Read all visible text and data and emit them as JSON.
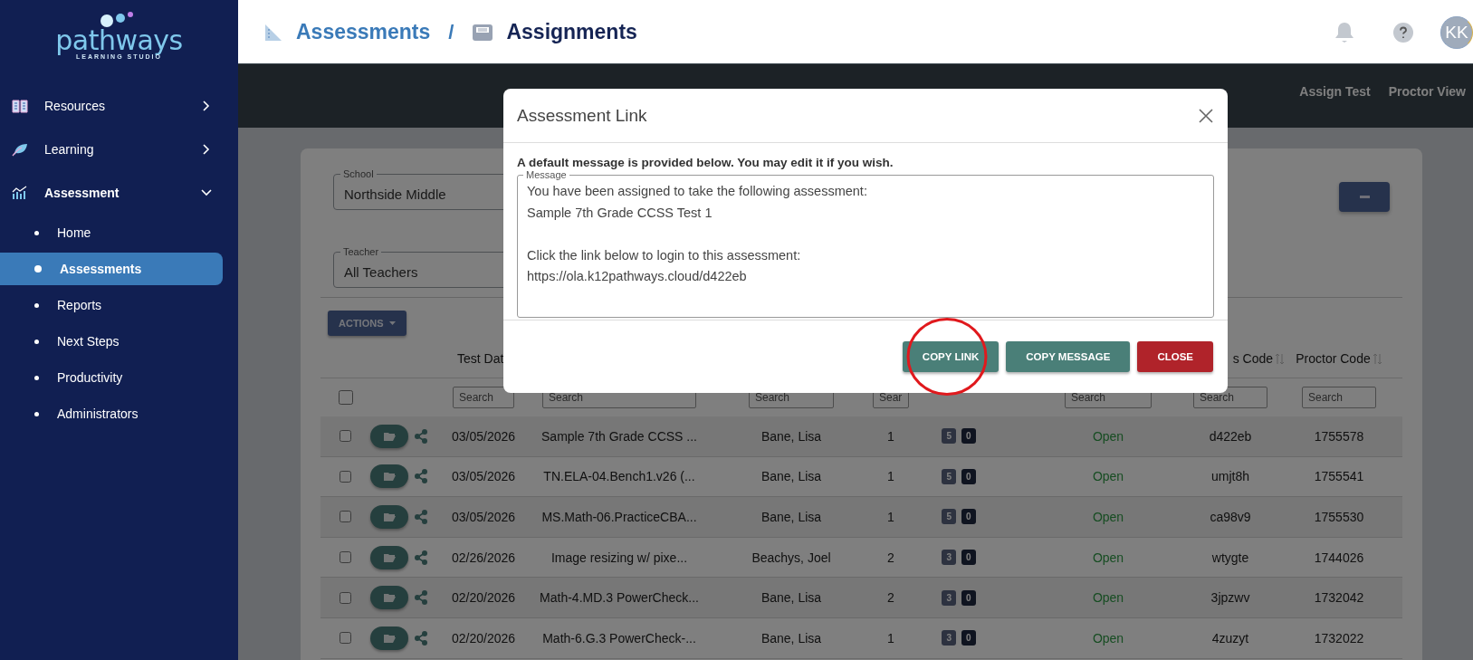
{
  "sidebar": {
    "logo": {
      "name": "pathways",
      "tagline": "LEARNING STUDIO"
    },
    "items": [
      {
        "label": "Resources",
        "expanded": false
      },
      {
        "label": "Learning",
        "expanded": false
      },
      {
        "label": "Assessment",
        "expanded": true,
        "children": [
          {
            "label": "Home",
            "selected": false
          },
          {
            "label": "Assessments",
            "selected": true
          },
          {
            "label": "Reports",
            "selected": false
          },
          {
            "label": "Next Steps",
            "selected": false
          },
          {
            "label": "Productivity",
            "selected": false
          },
          {
            "label": "Administrators",
            "selected": false
          }
        ]
      }
    ]
  },
  "header": {
    "breadcrumb": [
      {
        "label": "Assessments"
      },
      {
        "label": "Assignments"
      }
    ],
    "separator": "/",
    "avatar": "KK"
  },
  "toolbar": {
    "links": [
      "Assign Test",
      "Proctor View"
    ]
  },
  "filters": [
    {
      "label": "School",
      "value": "Northside Middle"
    },
    {
      "label": "Teacher",
      "value": "All Teachers"
    }
  ],
  "actions_button": "ACTIONS",
  "table": {
    "select_all": {
      "checked": false
    },
    "columns": [
      {
        "kind": "text",
        "label": "Test Dat",
        "placeholder": "Search"
      },
      {
        "kind": "text",
        "placeholder": "Search"
      },
      {
        "kind": "text",
        "placeholder": "Search"
      },
      {
        "kind": "text",
        "placeholder": "Sear"
      },
      {
        "kind": "badges"
      },
      {
        "kind": "status",
        "placeholder": "Search"
      },
      {
        "kind": "text",
        "label": "s Code",
        "sortable": true,
        "placeholder": "Search"
      },
      {
        "kind": "text",
        "label": "Proctor Code",
        "sortable": true,
        "placeholder": "Search"
      }
    ],
    "rows": [
      {
        "checked": false,
        "cells": [
          "03/05/2026",
          "Sample 7th Grade CCSS ...",
          "Bane, Lisa",
          "1",
          [
            "5",
            "0"
          ],
          "Open",
          "d422eb",
          "1755578"
        ]
      },
      {
        "checked": false,
        "cells": [
          "03/05/2026",
          "TN.ELA-04.Bench1.v26 (...",
          "Bane, Lisa",
          "1",
          [
            "5",
            "0"
          ],
          "Open",
          "umjt8h",
          "1755541"
        ]
      },
      {
        "checked": false,
        "cells": [
          "03/05/2026",
          "MS.Math-06.PracticeCBA...",
          "Bane, Lisa",
          "1",
          [
            "5",
            "0"
          ],
          "Open",
          "ca98v9",
          "1755530"
        ]
      },
      {
        "checked": false,
        "cells": [
          "02/26/2026",
          "Image resizing w/ pixe...",
          "Beachys, Joel",
          "2",
          [
            "3",
            "0"
          ],
          "Open",
          "wtygte",
          "1744026"
        ]
      },
      {
        "checked": false,
        "cells": [
          "02/20/2026",
          "Math-4.MD.3 PowerCheck...",
          "Bane, Lisa",
          "2",
          [
            "3",
            "0"
          ],
          "Open",
          "3jpzwv",
          "1732042"
        ]
      },
      {
        "checked": false,
        "cells": [
          "02/20/2026",
          "Math-6.G.3 PowerCheck-...",
          "Bane, Lisa",
          "1",
          [
            "3",
            "0"
          ],
          "Open",
          "4zuzyt",
          "1732022"
        ]
      }
    ]
  },
  "modal": {
    "title": "Assessment Link",
    "intro": "A default message is provided below. You may edit it if you wish.",
    "field_label": "Message",
    "message": "You have been assigned to take the following assessment:\nSample 7th Grade CCSS Test 1\n\nClick the link below to login to this assessment:\nhttps://ola.k12pathways.cloud/d422eb",
    "buttons": [
      {
        "label": "COPY LINK",
        "kind": "primary",
        "highlighted": true
      },
      {
        "label": "COPY MESSAGE",
        "kind": "primary",
        "highlighted": false
      },
      {
        "label": "CLOSE",
        "kind": "danger",
        "highlighted": false
      }
    ]
  }
}
